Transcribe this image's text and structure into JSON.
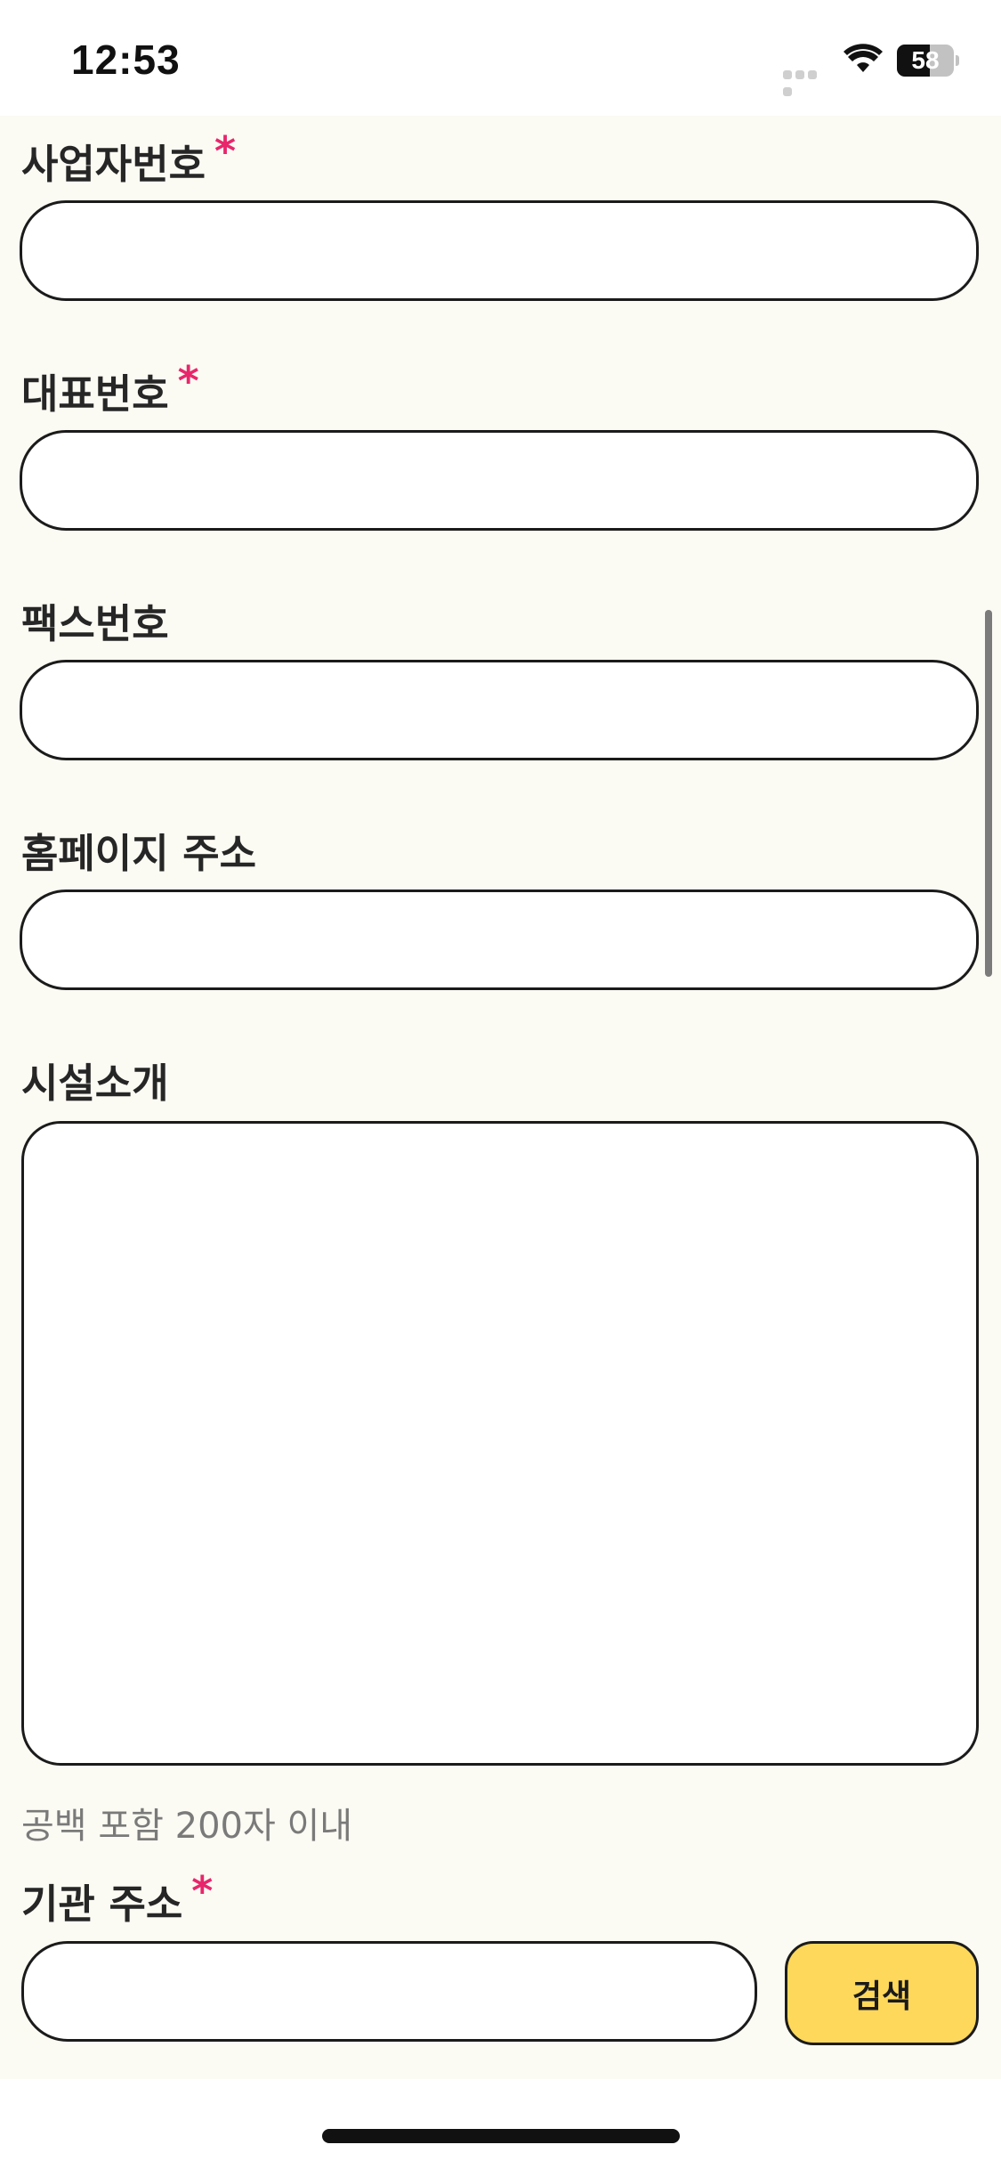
{
  "status_bar": {
    "time": "12:53",
    "battery_level": "58",
    "icons": [
      "cellular-signal-icon",
      "wifi-icon",
      "battery-icon"
    ]
  },
  "form": {
    "business_number": {
      "label": "사업자번호",
      "required": true,
      "required_mark": "*",
      "value": ""
    },
    "main_phone": {
      "label": "대표번호",
      "required": true,
      "required_mark": "*",
      "value": ""
    },
    "fax_number": {
      "label": "팩스번호",
      "value": ""
    },
    "homepage": {
      "label": "홈페이지 주소",
      "value": ""
    },
    "facility_intro": {
      "label": "시설소개",
      "value": "",
      "helper": "공백 포함 200자 이내"
    },
    "org_address": {
      "label": "기관 주소",
      "required": true,
      "required_mark": "*",
      "value": "",
      "search_label": "검색"
    }
  },
  "colors": {
    "background": "#fbfaf3",
    "required": "#e8266b",
    "search_button": "#fdd85b",
    "border": "#1b1b1b"
  }
}
